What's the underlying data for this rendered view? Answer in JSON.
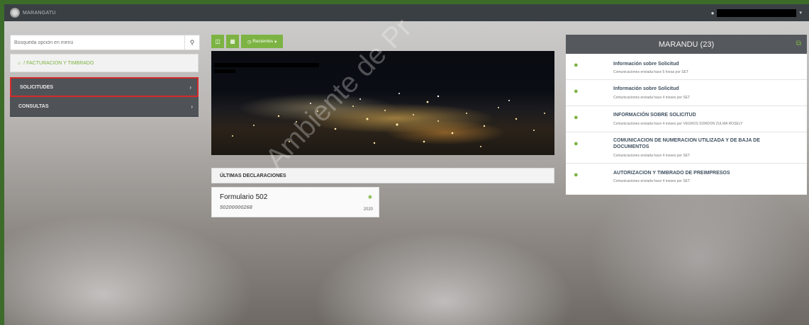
{
  "topbar": {
    "brand": "MARANGATU"
  },
  "sidebar": {
    "search_placeholder": "Búsqueda opción en menú",
    "breadcrumb": "/ FACTURACION Y TIMBRADO",
    "items": [
      {
        "label": "SOLICITUDES"
      },
      {
        "label": "CONSULTAS"
      }
    ]
  },
  "toolbar": {
    "recientes_label": "Recientes"
  },
  "declarations": {
    "heading": "ÚLTIMAS DECLARACIONES",
    "card": {
      "title": "Formulario 502",
      "number": "50200000268",
      "year": "2020"
    }
  },
  "watermark": "Ambiente de Pr",
  "notifications": {
    "title": "MARANDU (23)",
    "items": [
      {
        "title": "Información sobre Solicitud",
        "sub": "Comunicaciones enviada hace 5 horas por SET"
      },
      {
        "title": "Información sobre Solicitud",
        "sub": "Comunicaciones enviada hace 4 meses por SET"
      },
      {
        "title": "INFORMACIÓN SOBRE SOLICITUD",
        "sub": "Comunicaciones enviada hace 4 meses por VEGROS SORDON ZULMA ROSELY"
      },
      {
        "title": "COMUNICACION DE NUMERACION UTILIZADA Y DE BAJA DE DOCUMENTOS",
        "sub": "Comunicaciones enviada hace 4 meses por SET"
      },
      {
        "title": "AUTORIZACION Y TIMBRADO DE PREIMPRESOS",
        "sub": "Comunicaciones enviada hace 4 meses por SET"
      }
    ]
  },
  "colors": {
    "accent": "#7cb342",
    "topbar": "#3a3f44",
    "menu": "#4f5357",
    "highlight": "#d32a2a"
  },
  "icons": [
    "logo-icon",
    "user-icon",
    "search-icon",
    "home-icon",
    "chevron-right-icon",
    "file-icon",
    "calculator-icon",
    "clock-icon",
    "eye-icon",
    "external-link-icon",
    "chat-icon"
  ]
}
